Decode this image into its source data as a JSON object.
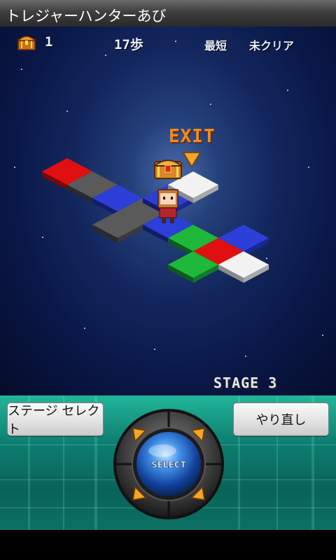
{
  "app": {
    "title": "トレジャーハンターあび"
  },
  "hud": {
    "treasure_count": "1",
    "steps": "17歩",
    "best_label": "最短",
    "best_value": "未クリア"
  },
  "game": {
    "exit_label": "EXIT",
    "stage_label": "STAGE 3"
  },
  "controls": {
    "stage_select_label": "ステージ セレクト",
    "retry_label": "やり直し",
    "select_label": "SELECT"
  },
  "tile_colors": {
    "red": "#e01010",
    "gray": "#5a5a5a",
    "blue": "#2c3fd8",
    "white": "#f2f2f2",
    "green": "#1fb83a"
  }
}
